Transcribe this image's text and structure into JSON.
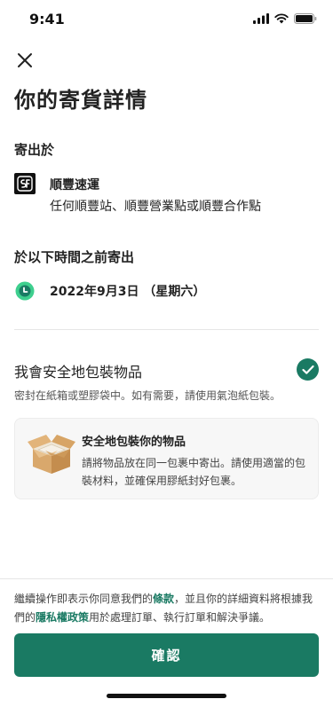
{
  "status_bar": {
    "time": "9:41"
  },
  "header": {
    "close_icon": "close-icon",
    "title": "你的寄貨詳情"
  },
  "ship_from": {
    "section_title": "寄出於",
    "courier_logo": "sf-express-logo",
    "courier_name": "順豐速運",
    "courier_desc": "任何順豐站、順豐營業點或順豐合作點"
  },
  "deadline": {
    "section_title": "於以下時間之前寄出",
    "icon": "clock-icon",
    "date": "2022年9月3日 （星期六）"
  },
  "packaging": {
    "label": "我會安全地包裝物品",
    "checked": true,
    "hint": "密封在紙箱或塑膠袋中。如有需要，請使用氣泡紙包裝。",
    "tip_title": "安全地包裝你的物品",
    "tip_body": "請將物品放在同一包裹中寄出。請使用適當的包裝材料，並確保用膠紙封好包裹。"
  },
  "terms": {
    "text_before": "繼續操作即表示你同意我們的",
    "terms_link": "條款",
    "text_middle": "，並且你的詳細資料將根據我們的",
    "privacy_link": "隱私權政策",
    "text_after": "用於處理訂單、執行訂單和解決爭議。"
  },
  "confirm_button": {
    "label": "確認"
  },
  "colors": {
    "accent": "#1a7a63",
    "clock_green": "#3ecf8e",
    "card_bg": "#f7f7f7"
  }
}
